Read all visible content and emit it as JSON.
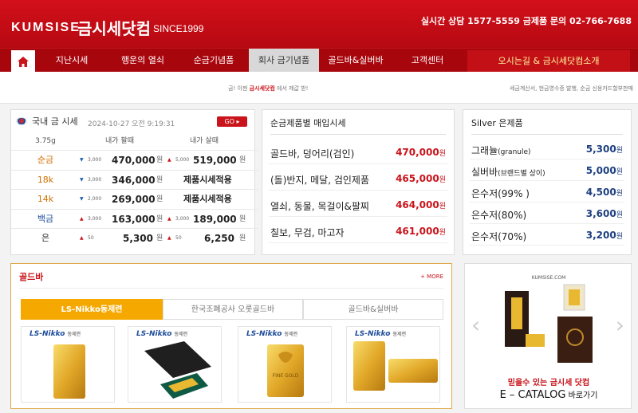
{
  "header": {
    "logo_en": "KUMSISE",
    "logo_kr": "금시세닷컴",
    "since": "SINCE1999",
    "contact": "실시간 상담 1577-5559   금제품 문의 02-766-7688"
  },
  "nav": {
    "items": [
      "지난시세",
      "행운의 열쇠",
      "순금기념품",
      "회사 금기념품",
      "골드바&실버바",
      "고객센터"
    ],
    "right": "오시는길 & 금시세닷컴소개"
  },
  "subbar": {
    "center_pre": "금! 이젠 ",
    "center_brand": "금시세닷컴",
    "center_post": " 에서 제값 받!",
    "right": "세금계산서, 현금영수증 발행, 순금 신용카드할부판매"
  },
  "domestic": {
    "title": "국내 금 시세",
    "date": "2024-10-27 오전 9:19:31",
    "go": "GO ▸",
    "headers": [
      "3.75g",
      "내가 팔때",
      "내가 살때"
    ],
    "rows": [
      {
        "label": "순금",
        "sell_arrow": "▼",
        "sell_change": "3,000",
        "sell_price": "470,000",
        "sell_unit": "원",
        "buy_arrow": "▲",
        "buy_change": "5,000",
        "buy_price": "519,000",
        "buy_unit": "원"
      },
      {
        "label": "18k",
        "sell_arrow": "▼",
        "sell_change": "3,000",
        "sell_price": "346,000",
        "sell_unit": "원",
        "buy_text": "제품시세적용"
      },
      {
        "label": "14k",
        "sell_arrow": "▼",
        "sell_change": "2,000",
        "sell_price": "269,000",
        "sell_unit": "원",
        "buy_text": "제품시세적용"
      },
      {
        "label": "백금",
        "sell_arrow": "▲",
        "sell_change": "3,000",
        "sell_price": "163,000",
        "sell_unit": "원",
        "buy_arrow": "▲",
        "buy_change": "3,000",
        "buy_price": "189,000",
        "buy_unit": "원"
      },
      {
        "label": "은",
        "sell_arrow": "▲",
        "sell_change": "50",
        "sell_price": "5,300",
        "sell_unit": "원",
        "buy_arrow": "▲",
        "buy_change": "50",
        "buy_price": "6,250",
        "buy_unit": "원"
      }
    ]
  },
  "pure_gold": {
    "title": "순금제품별 매입시세",
    "rows": [
      {
        "name": "골드바, 덩어리(검인)",
        "price": "470,000",
        "unit": "원"
      },
      {
        "name": "(돌)반지, 메달, 검인제품",
        "price": "465,000",
        "unit": "원"
      },
      {
        "name": "열쇠, 동물, 목걸이&팔찌",
        "price": "464,000",
        "unit": "원"
      },
      {
        "name": "칠보, 무검, 마고자",
        "price": "461,000",
        "unit": "원"
      }
    ]
  },
  "silver": {
    "title": "Silver 은제품",
    "rows": [
      {
        "name": "그래뉼",
        "sub": "(granule)",
        "price": "5,300",
        "unit": "원"
      },
      {
        "name": "실버바",
        "sub": "(브랜드별 상이)",
        "price": "5,000",
        "unit": "원"
      },
      {
        "name": "은수저(99% )",
        "sub": "",
        "price": "4,500",
        "unit": "원"
      },
      {
        "name": "은수저(80%)",
        "sub": "",
        "price": "3,600",
        "unit": "원"
      },
      {
        "name": "은수저(70%)",
        "sub": "",
        "price": "3,200",
        "unit": "원"
      }
    ]
  },
  "goldbar": {
    "title": "골드바",
    "more": "+ MORE",
    "tabs": [
      "LS-Nikko동제련",
      "한국조폐공사 오롯골드바",
      "골드바&실버바"
    ],
    "brand": "LS-Nikko",
    "brand_sub": "동제련",
    "fine_gold": "FINE GOLD"
  },
  "catalog": {
    "logo": "KUMSISE.COM",
    "line1": "믿을수 있는 금시세 닷컴",
    "line2": "E – CATALOG",
    "line2_small": " 바로가기"
  },
  "colors": {
    "brand_red": "#c9141b",
    "nav_red": "#a8060d",
    "tab_gold": "#f5a800",
    "gold": "#e8b830"
  }
}
